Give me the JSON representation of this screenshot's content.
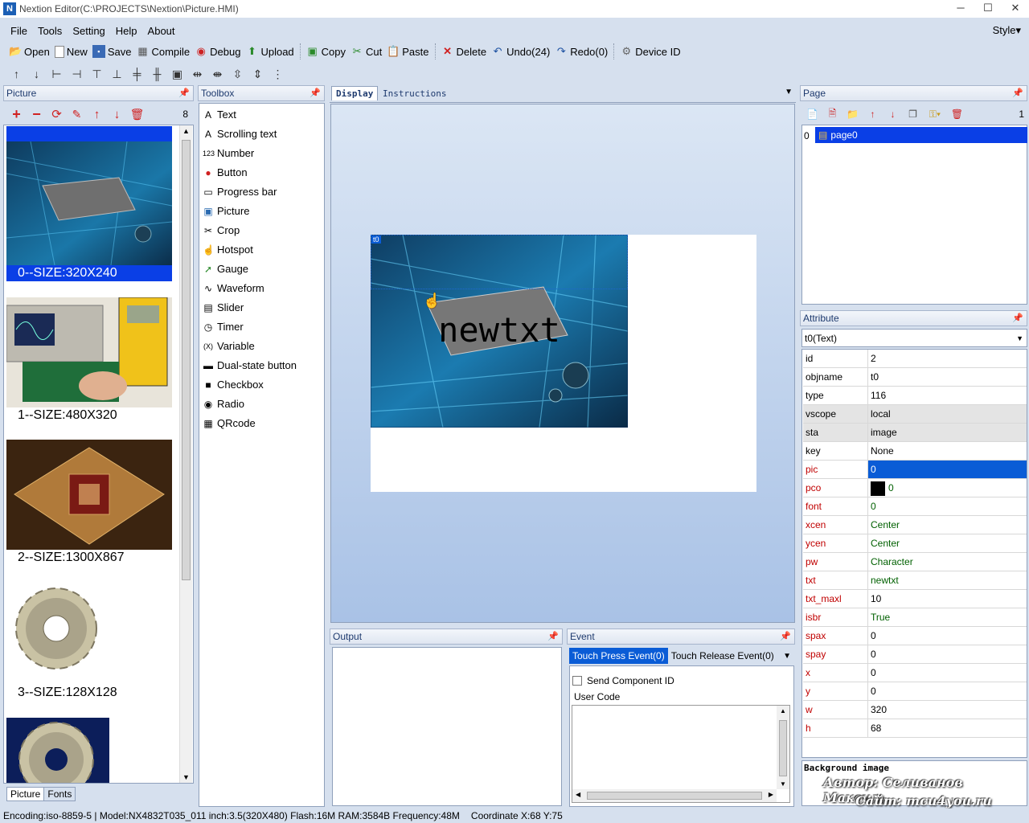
{
  "window": {
    "app_icon": "N",
    "title": "Nextion Editor(C:\\PROJECTS\\Nextion\\Picture.HMI)",
    "min": "─",
    "max": "☐",
    "close": "✕"
  },
  "menu": {
    "items": [
      "File",
      "Tools",
      "Setting",
      "Help",
      "About"
    ],
    "style": "Style▾"
  },
  "toolbar": {
    "open": "Open",
    "new": "New",
    "save": "Save",
    "compile": "Compile",
    "debug": "Debug",
    "upload": "Upload",
    "copy": "Copy",
    "cut": "Cut",
    "paste": "Paste",
    "delete": "Delete",
    "undo": "Undo(24)",
    "redo": "Redo(0)",
    "device_id": "Device  ID"
  },
  "picture_panel": {
    "title": "Picture",
    "count": "8",
    "items": [
      {
        "label": "0--SIZE:320X240"
      },
      {
        "label": "1--SIZE:480X320"
      },
      {
        "label": "2--SIZE:1300X867"
      },
      {
        "label": "3--SIZE:128X128"
      }
    ],
    "tab_picture": "Picture",
    "tab_fonts": "Fonts"
  },
  "toolbox": {
    "title": "Toolbox",
    "items": [
      {
        "label": "Text",
        "icon": "A"
      },
      {
        "label": "Scrolling text",
        "icon": "A"
      },
      {
        "label": "Number",
        "icon": "123"
      },
      {
        "label": "Button",
        "icon": "●"
      },
      {
        "label": "Progress bar",
        "icon": "▭"
      },
      {
        "label": "Picture",
        "icon": "▣"
      },
      {
        "label": "Crop",
        "icon": "✂"
      },
      {
        "label": "Hotspot",
        "icon": "☝"
      },
      {
        "label": "Gauge",
        "icon": "➚"
      },
      {
        "label": "Waveform",
        "icon": "∿"
      },
      {
        "label": "Slider",
        "icon": "▤"
      },
      {
        "label": "Timer",
        "icon": "◷"
      },
      {
        "label": "Variable",
        "icon": "(X)"
      },
      {
        "label": "Dual-state button",
        "icon": "▬"
      },
      {
        "label": "Checkbox",
        "icon": "■"
      },
      {
        "label": "Radio",
        "icon": "◉"
      },
      {
        "label": "QRcode",
        "icon": "▦"
      }
    ]
  },
  "display": {
    "tab_display": "Display",
    "tab_instructions": "Instructions",
    "component_tag": "t0",
    "component_text": "newtxt"
  },
  "output": {
    "title": "Output"
  },
  "event": {
    "title": "Event",
    "tab_press": "Touch Press Event(0)",
    "tab_release": "Touch Release Event(0)",
    "send_component_id": "Send Component ID",
    "user_code": "User Code"
  },
  "page_panel": {
    "title": "Page",
    "count": "1",
    "page_index": "0",
    "page_name": "page0"
  },
  "attribute": {
    "title": "Attribute",
    "selected": "t0(Text)",
    "rows": [
      {
        "k": "id",
        "v": "2"
      },
      {
        "k": "objname",
        "v": "t0"
      },
      {
        "k": "type",
        "v": "116"
      },
      {
        "k": "vscope",
        "v": "local"
      },
      {
        "k": "sta",
        "v": "image"
      },
      {
        "k": "key",
        "v": "None"
      },
      {
        "k": "pic",
        "v": "0"
      },
      {
        "k": "pco",
        "v": "0"
      },
      {
        "k": "font",
        "v": "0"
      },
      {
        "k": "xcen",
        "v": "Center"
      },
      {
        "k": "ycen",
        "v": "Center"
      },
      {
        "k": "pw",
        "v": "Character"
      },
      {
        "k": "txt",
        "v": "newtxt"
      },
      {
        "k": "txt_maxl",
        "v": "10"
      },
      {
        "k": "isbr",
        "v": "True"
      },
      {
        "k": "spax",
        "v": "0"
      },
      {
        "k": "spay",
        "v": "0"
      },
      {
        "k": "x",
        "v": "0"
      },
      {
        "k": "y",
        "v": "0"
      },
      {
        "k": "w",
        "v": "320"
      },
      {
        "k": "h",
        "v": "68"
      }
    ],
    "description": "Background image",
    "watermark_line1": "Автор: Селиванов Максим",
    "watermark_line2": "Сайт: mcu4you.ru"
  },
  "status": {
    "text": "Encoding:iso-8859-5 | Model:NX4832T035_011  inch:3.5(320X480) Flash:16M RAM:3584B Frequency:48M",
    "coord": "Coordinate X:68  Y:75"
  },
  "colors": {
    "selection": "#0a5cd6",
    "panel_border": "#8fa0bb",
    "canvas_bg": "#b8cdea",
    "attr_gray": "#e4e4e4",
    "red_name": "#c00000",
    "value_green": "#006000"
  }
}
